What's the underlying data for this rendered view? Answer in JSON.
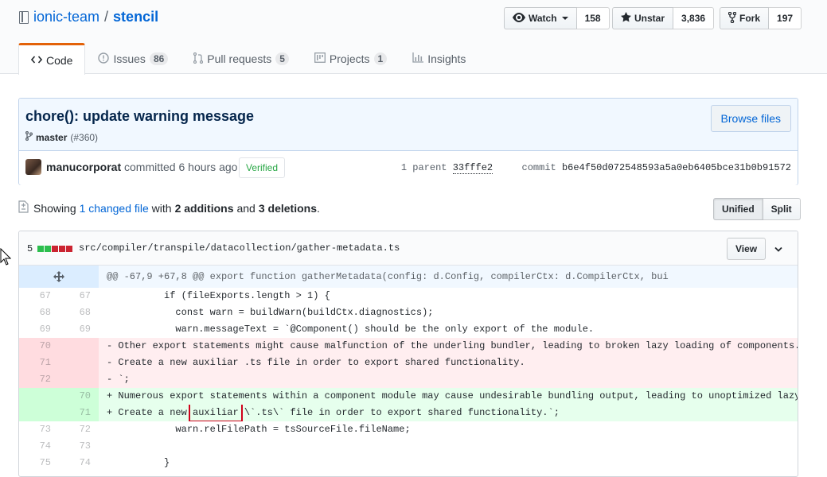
{
  "repo": {
    "owner": "ionic-team",
    "separator": "/",
    "name": "stencil"
  },
  "actions": {
    "watch": {
      "label": "Watch",
      "count": "158"
    },
    "star": {
      "label": "Unstar",
      "count": "3,836"
    },
    "fork": {
      "label": "Fork",
      "count": "197"
    }
  },
  "nav": [
    {
      "label": "Code",
      "icon": "code-icon",
      "selected": true
    },
    {
      "label": "Issues",
      "icon": "issue-icon",
      "count": "86"
    },
    {
      "label": "Pull requests",
      "icon": "pull-request-icon",
      "count": "5"
    },
    {
      "label": "Projects",
      "icon": "project-icon",
      "count": "1"
    },
    {
      "label": "Insights",
      "icon": "graph-icon"
    }
  ],
  "commit": {
    "title": "chore(): update warning message",
    "branch": "master",
    "pr": "(#360)",
    "browse_label": "Browse files",
    "author": "manucorporat",
    "committed_text": " committed 6 hours ago",
    "verified_label": "Verified",
    "parent_label": "1 parent",
    "parent_sha": "33fffe2",
    "commit_label": "commit",
    "sha": "b6e4f50d072548593a5a0eb6405bce31b0b91572"
  },
  "toc": {
    "showing": "Showing",
    "changed": "1 changed file",
    "with": "with",
    "additions": "2 additions",
    "and": "and",
    "deletions": "3 deletions",
    "period": "."
  },
  "diff_toggle": {
    "unified": "Unified",
    "split": "Split"
  },
  "file": {
    "changes": "5",
    "diffstat": {
      "additions": 2,
      "deletions": 3
    },
    "path": "src/compiler/transpile/datacollection/gather-metadata.ts",
    "view_label": "View",
    "hunk": "@@ -67,9 +67,8 @@ export function gatherMetadata(config: d.Config, compilerCtx: d.CompilerCtx, bui",
    "lines": [
      {
        "type": "ctx",
        "old": "67",
        "new": "67",
        "text": "          if (fileExports.length > 1) {"
      },
      {
        "type": "ctx",
        "old": "68",
        "new": "68",
        "text": "            const warn = buildWarn(buildCtx.diagnostics);"
      },
      {
        "type": "ctx",
        "old": "69",
        "new": "69",
        "text": "            warn.messageText = `@Component() should be the only export of the module."
      },
      {
        "type": "del",
        "old": "70",
        "new": "",
        "text": "- Other export statements might cause malfunction of the underling bundler, leading to broken lazy loading of components."
      },
      {
        "type": "del",
        "old": "71",
        "new": "",
        "text": "- Create a new auxiliar .ts file in order to export shared functionality."
      },
      {
        "type": "del",
        "old": "72",
        "new": "",
        "text": "- `;"
      },
      {
        "type": "add",
        "old": "",
        "new": "70",
        "text": "+ Numerous export statements within a component module may cause undesirable bundling output, leading to unoptimized lazy loading."
      },
      {
        "type": "add",
        "old": "",
        "new": "71",
        "text": "+ Create a new auxiliar \\`.ts\\` file in order to export shared functionality.`;"
      },
      {
        "type": "ctx",
        "old": "73",
        "new": "72",
        "text": "            warn.relFilePath = tsSourceFile.fileName;"
      },
      {
        "type": "ctx",
        "old": "74",
        "new": "73",
        "text": ""
      },
      {
        "type": "ctx",
        "old": "75",
        "new": "74",
        "text": "          }"
      }
    ]
  },
  "colors": {
    "link": "#0366d6",
    "nav_accent": "#e36209",
    "add_bg": "#e6ffed",
    "del_bg": "#ffeef0",
    "highlight_box": "#d0021b"
  }
}
